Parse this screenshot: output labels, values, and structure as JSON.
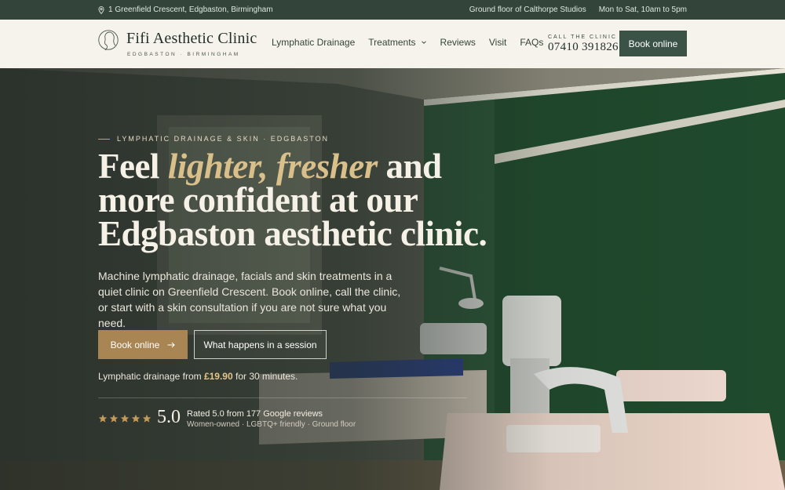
{
  "topbar": {
    "address": "1 Greenfield Crescent, Edgbaston, Birmingham",
    "location_note": "Ground floor of Calthorpe Studios",
    "hours": "Mon to Sat, 10am to 5pm",
    "pin_icon": "map-pin-icon"
  },
  "header": {
    "brand": "Fifi Aesthetic Clinic",
    "brand_sub": "EDGBASTON · BIRMINGHAM",
    "nav": [
      {
        "label": "Lymphatic Drainage"
      },
      {
        "label": "Treatments"
      },
      {
        "label": "Reviews"
      },
      {
        "label": "Visit"
      },
      {
        "label": "FAQs"
      }
    ],
    "call_label": "CALL THE CLINIC",
    "phone": "07410 391826",
    "book_label": "Book online"
  },
  "hero": {
    "eyebrow": "LYMPHATIC DRAINAGE & SKIN · EDGBASTON",
    "headline_pre": "Feel ",
    "headline_accent": "lighter, fresher",
    "headline_post": " and more confident at our Edgbaston aesthetic clinic.",
    "lede": "Machine lymphatic drainage, facials and skin treatments in a quiet clinic on Greenfield Crescent. Book online, call the clinic, or start with a skin consultation if you are not sure what you need.",
    "primary_cta": "Book online",
    "secondary_cta": "What happens in a session",
    "price_pre": "Lymphatic drainage from ",
    "price_value": "£19.90",
    "price_post": " for 30 minutes.",
    "rating_value": "5.0",
    "star_count": 5,
    "rated_text": "Rated 5.0 from 177 Google reviews",
    "tags_text": "Women-owned · LGBTQ+ friendly · Ground floor"
  },
  "colors": {
    "topbar": "#33453a",
    "header_bg": "#f6f3ec",
    "primary_button": "#a88552",
    "header_button": "#3b5346",
    "accent_text": "#d9bf8a"
  }
}
